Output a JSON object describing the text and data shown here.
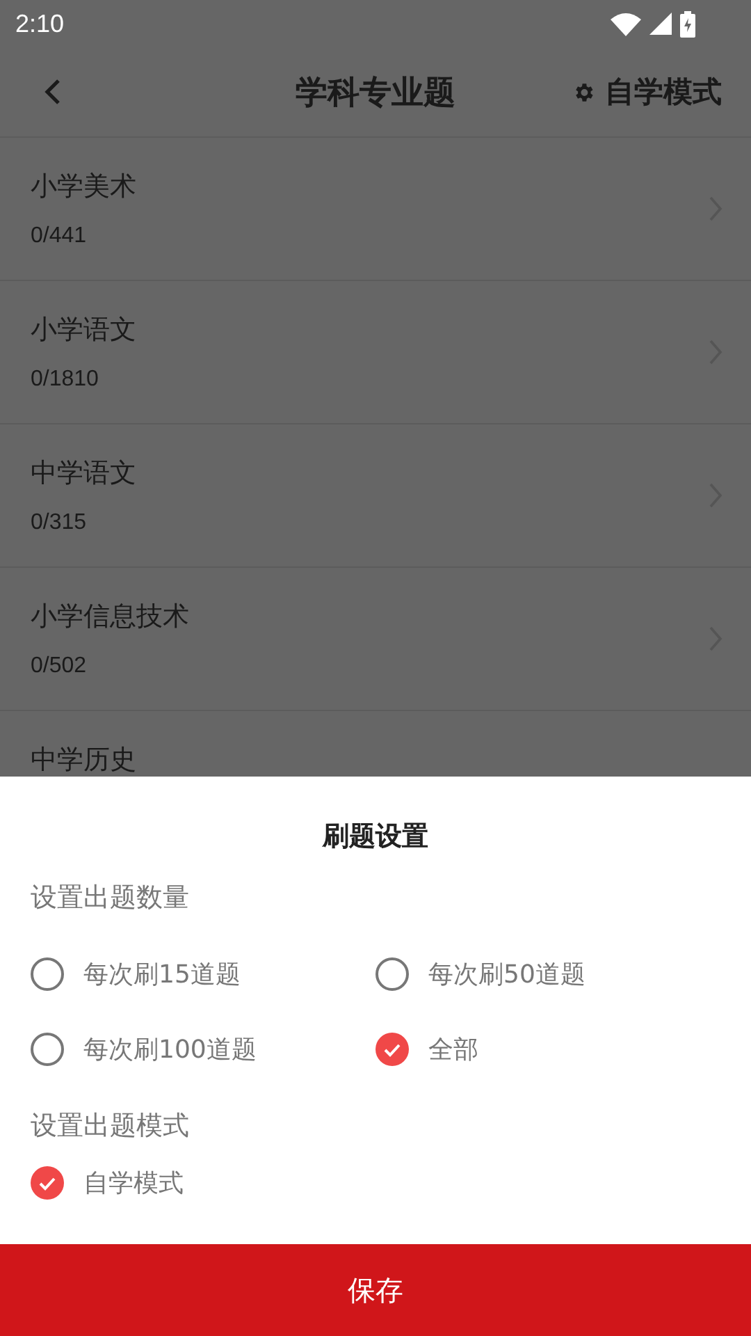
{
  "status_bar": {
    "time": "2:10"
  },
  "header": {
    "title": "学科专业题",
    "action": "自学模式"
  },
  "subjects": [
    {
      "name": "小学美术",
      "progress": "0/441"
    },
    {
      "name": "小学语文",
      "progress": "0/1810"
    },
    {
      "name": "中学语文",
      "progress": "0/315"
    },
    {
      "name": "小学信息技术",
      "progress": "0/502"
    },
    {
      "name": "中学历史"
    }
  ],
  "sheet": {
    "title": "刷题设置",
    "count_label": "设置出题数量",
    "count_options": [
      {
        "label": "每次刷15道题",
        "selected": false
      },
      {
        "label": "每次刷50道题",
        "selected": false
      },
      {
        "label": "每次刷100道题",
        "selected": false
      },
      {
        "label": "全部",
        "selected": true
      }
    ],
    "mode_label": "设置出题模式",
    "mode_options": [
      {
        "label": "自学模式",
        "selected": true
      }
    ],
    "save_button": "保存"
  }
}
